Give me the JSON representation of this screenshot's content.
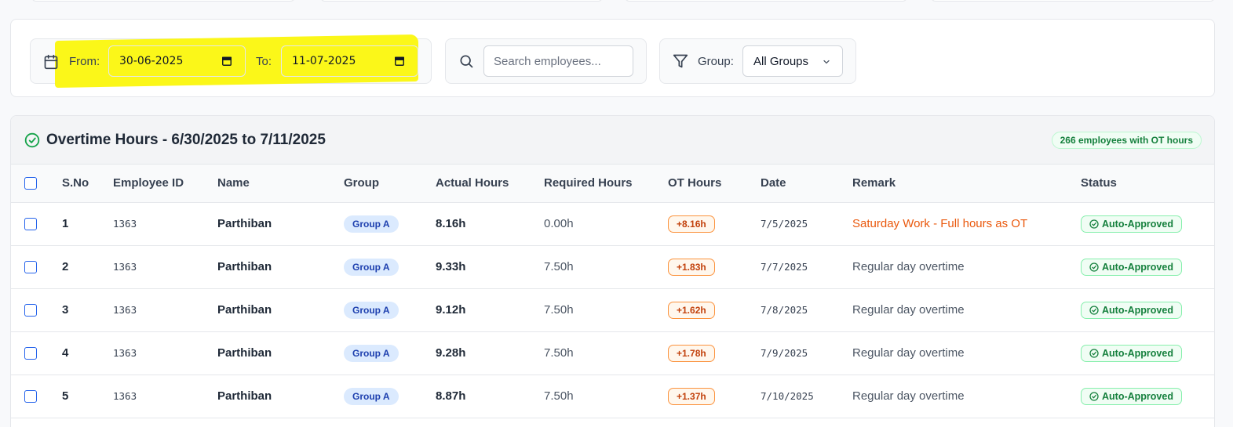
{
  "filters": {
    "from_label": "From:",
    "from_value": "30-06-2025",
    "to_label": "To:",
    "to_value": "11-07-2025",
    "search_placeholder": "Search employees...",
    "group_label": "Group:",
    "group_value": "All Groups"
  },
  "table_card": {
    "title": "Overtime Hours - 6/30/2025 to 7/11/2025",
    "count_badge": "266 employees with OT hours",
    "headers": [
      "S.No",
      "Employee ID",
      "Name",
      "Group",
      "Actual Hours",
      "Required Hours",
      "OT Hours",
      "Date",
      "Remark",
      "Status"
    ],
    "rows": [
      {
        "sno": "1",
        "emp_id": "1363",
        "name": "Parthiban",
        "group": "Group A",
        "actual": "8.16h",
        "required": "0.00h",
        "ot": "+8.16h",
        "date": "7/5/2025",
        "remark": "Saturday Work - Full hours as OT",
        "remark_type": "saturday",
        "status": "Auto-Approved"
      },
      {
        "sno": "2",
        "emp_id": "1363",
        "name": "Parthiban",
        "group": "Group A",
        "actual": "9.33h",
        "required": "7.50h",
        "ot": "+1.83h",
        "date": "7/7/2025",
        "remark": "Regular day overtime",
        "remark_type": "regular",
        "status": "Auto-Approved"
      },
      {
        "sno": "3",
        "emp_id": "1363",
        "name": "Parthiban",
        "group": "Group A",
        "actual": "9.12h",
        "required": "7.50h",
        "ot": "+1.62h",
        "date": "7/8/2025",
        "remark": "Regular day overtime",
        "remark_type": "regular",
        "status": "Auto-Approved"
      },
      {
        "sno": "4",
        "emp_id": "1363",
        "name": "Parthiban",
        "group": "Group A",
        "actual": "9.28h",
        "required": "7.50h",
        "ot": "+1.78h",
        "date": "7/9/2025",
        "remark": "Regular day overtime",
        "remark_type": "regular",
        "status": "Auto-Approved"
      },
      {
        "sno": "5",
        "emp_id": "1363",
        "name": "Parthiban",
        "group": "Group A",
        "actual": "8.87h",
        "required": "7.50h",
        "ot": "+1.37h",
        "date": "7/10/2025",
        "remark": "Regular day overtime",
        "remark_type": "regular",
        "status": "Auto-Approved"
      }
    ]
  },
  "colors": {
    "highlight": "#fbf719",
    "accent_blue": "#2563eb",
    "ot_orange": "#c2410c",
    "status_green": "#15803d"
  },
  "icons": {
    "date": "calendar-icon",
    "search": "search-icon",
    "filter": "filter-icon",
    "select": "chevron-down-icon",
    "title": "check-circle-icon",
    "status": "check-circle-icon"
  }
}
